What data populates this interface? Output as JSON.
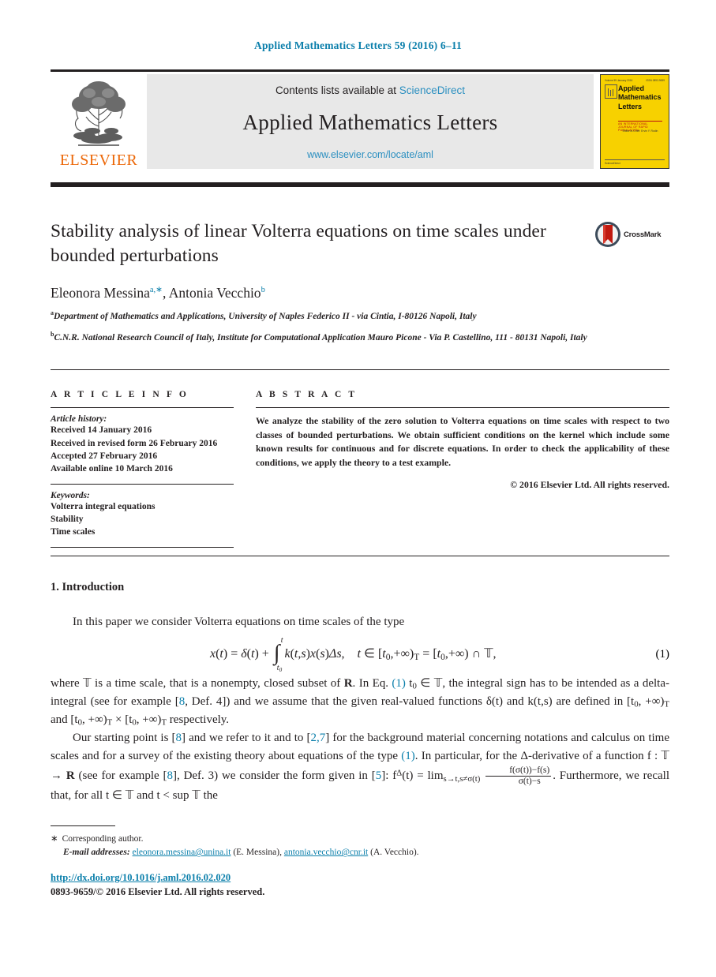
{
  "running_head": "Applied Mathematics Letters 59 (2016) 6–11",
  "header": {
    "publisher": "ELSEVIER",
    "contents_prefix": "Contents lists available at ",
    "sciencedirect": "ScienceDirect",
    "journal_name": "Applied Mathematics Letters",
    "journal_url": "www.elsevier.com/locate/aml",
    "cover": {
      "top_left": "Volume 59  January 2016",
      "top_right": "ISSN 0893-9659",
      "line1": "Applied",
      "line2": "Mathematics",
      "line3": "Letters",
      "red_line": "AN INTERNATIONAL JOURNAL OF RAPID PUBLICATION",
      "sub": "Editor-in-Chief: Ervin Y. Rodin",
      "bottom": "ScienceDirect"
    },
    "accent_blue": "#2b8fc0",
    "elsevier_orange": "#ec6707",
    "cover_yellow": "#f7d100"
  },
  "article": {
    "title": "Stability analysis of linear Volterra equations on time scales under bounded perturbations",
    "crossmark_label": "CrossMark",
    "authors_html": "Eleonora Messina<sup>a,∗</sup>, Antonia Vecchio<sup>b</sup>",
    "affiliations": [
      {
        "marker": "a",
        "text": "Department of Mathematics and Applications, University of Naples Federico II - via Cintia, I-80126 Napoli, Italy"
      },
      {
        "marker": "b",
        "text": "C.N.R. National Research Council of Italy, Institute for Computational Application Mauro Picone - Via P. Castellino, 111 - 80131 Napoli, Italy"
      }
    ]
  },
  "info": {
    "label": "A R T I C L E   I N F O",
    "history_label": "Article history:",
    "history": [
      "Received 14 January 2016",
      "Received in revised form 26 February 2016",
      "Accepted 27 February 2016",
      "Available online 10 March 2016"
    ],
    "keywords_label": "Keywords:",
    "keywords": [
      "Volterra integral equations",
      "Stability",
      "Time scales"
    ]
  },
  "abstract": {
    "label": "A B S T R A C T",
    "text": "We analyze the stability of the zero solution to Volterra equations on time scales with respect to two classes of bounded perturbations. We obtain sufficient conditions on the kernel which include some known results for continuous and for discrete equations. In order to check the applicability of these conditions, we apply the theory to a test example.",
    "copyright": "© 2016 Elsevier Ltd. All rights reserved."
  },
  "body": {
    "section_heading": "1.  Introduction",
    "para1": "In this paper we consider Volterra equations on time scales of the type",
    "equation_number": "(1)",
    "equation_plain": "x(t) = δ(t) + ∫_{t0}^{t} k(t,s)x(s)Δs,   t ∈ [t0,+∞)T = [t0,+∞) ∩ 𝕋,",
    "para2_parts": {
      "a": "where 𝕋 is a time scale, that is a nonempty, closed subset of ",
      "R1": "R",
      "b": ". In Eq. ",
      "ref1": "(1)",
      "c": " t",
      "d": " ∈ 𝕋, the integral sign has to be intended as a delta-integral (see for example [",
      "ref2": "8",
      "e": ", Def. 4]) and we assume that the given real-valued functions δ(t) and k(t,s) are defined in [t",
      "f": ", +∞)",
      "g": " and [t",
      "h": ", +∞)",
      "i": " × [t",
      "j": ", +∞)",
      "k": " respectively."
    },
    "para3_parts": {
      "a": "Our starting point is [",
      "ref1": "8",
      "b": "] and we refer to it and to [",
      "ref2": "2,7",
      "c": "] for the background material concerning notations and calculus on time scales and for a survey of the existing theory about equations of the type ",
      "ref3": "(1)",
      "d": ". In particular, for the Δ-derivative of a function f : 𝕋 → ",
      "R1": "R",
      "e": " (see for example [",
      "ref4": "8",
      "f": "], Def. 3) we consider the form given in [",
      "ref5": "5",
      "g": "]: f",
      "h": "(t) = lim",
      "i": "s→t,s≠σ(t)",
      "frac_num": "f(σ(t))−f(s)",
      "frac_den": "σ(t)−s",
      "j": ". Furthermore, we recall that, for all t ∈ 𝕋 and t < sup 𝕋 the"
    }
  },
  "footnote": {
    "star": "∗",
    "corresponding": "Corresponding author.",
    "email_label": "E-mail addresses:",
    "email1": "eleonora.messina@unina.it",
    "email1_who": "(E. Messina),",
    "email2": "antonia.vecchio@cnr.it",
    "email2_who": "(A. Vecchio)."
  },
  "bottom": {
    "doi": "http://dx.doi.org/10.1016/j.aml.2016.02.020",
    "issn": "0893-9659/© 2016 Elsevier Ltd. All rights reserved."
  }
}
